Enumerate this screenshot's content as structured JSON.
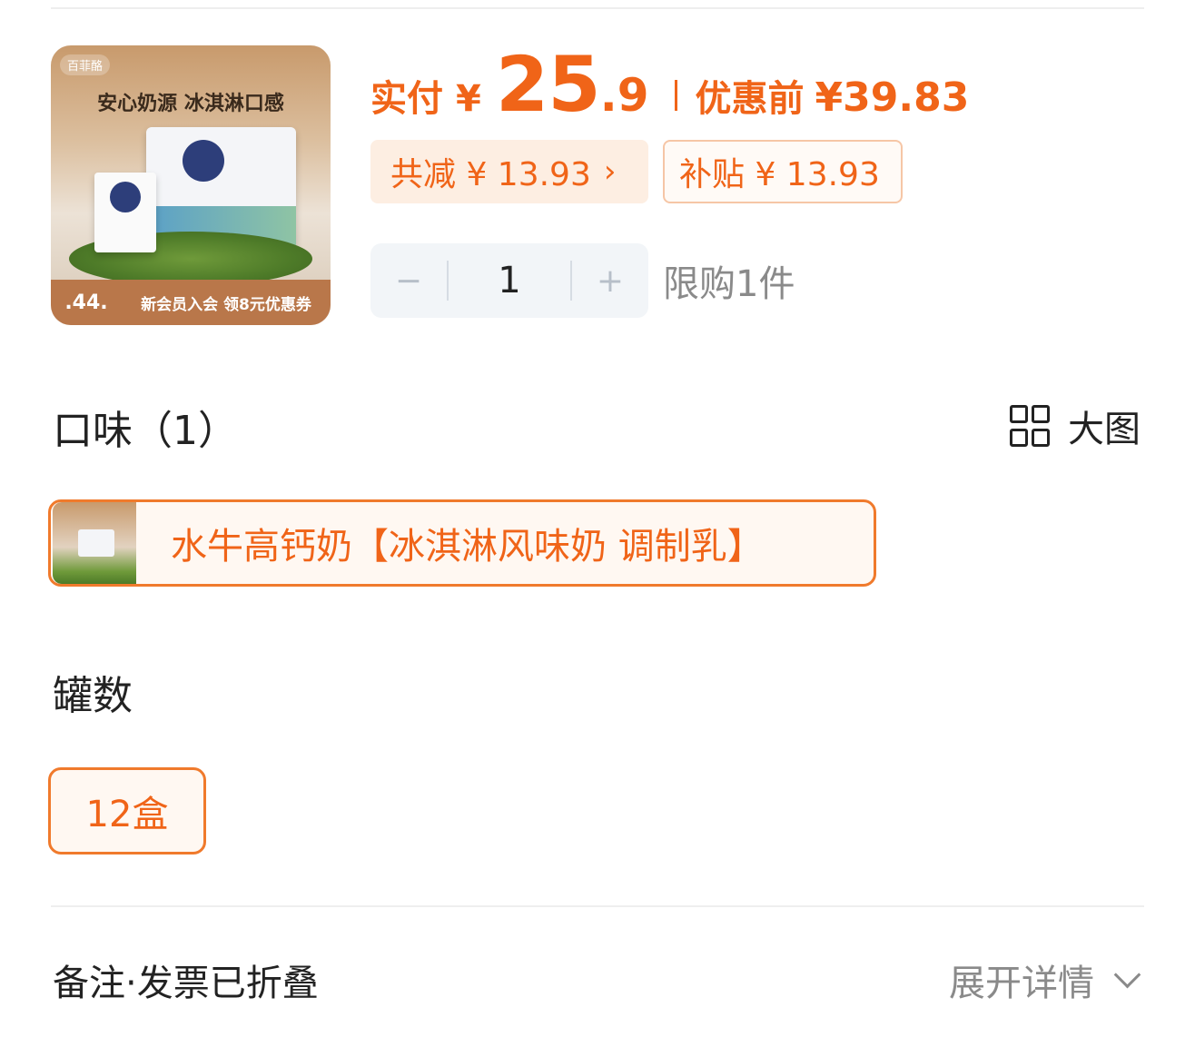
{
  "product": {
    "image_slogan": "安心奶源 冰淇淋口感",
    "image_brand": "百菲酪",
    "image_price": ".44.",
    "image_promo": "新会员入会 领8元优惠券"
  },
  "price": {
    "label": "实付",
    "currency": "¥",
    "integer": "25",
    "decimal": ".9",
    "original_label": "优惠前",
    "original_value": "¥39.83",
    "accent_color": "#f06418"
  },
  "discount_chip": {
    "text": "共减 ¥ 13.93",
    "arrow": "›"
  },
  "subsidy_chip": {
    "text": "补贴 ¥ 13.93"
  },
  "quantity": {
    "minus": "−",
    "value": "1",
    "plus": "+",
    "limit_text": "限购1件"
  },
  "flavor_section": {
    "title": "口味（1）",
    "big_view_label": "大图",
    "big_view_icon": "grid-icon",
    "options": [
      {
        "label": "水牛高钙奶【冰淇淋风味奶 调制乳】",
        "selected": true
      }
    ]
  },
  "count_section": {
    "title": "罐数",
    "options": [
      {
        "label": "12盒",
        "selected": true
      }
    ]
  },
  "notes": {
    "label": "备注·发票已折叠",
    "expand_label": "展开详情",
    "expand_icon": "chevron-down-icon"
  }
}
